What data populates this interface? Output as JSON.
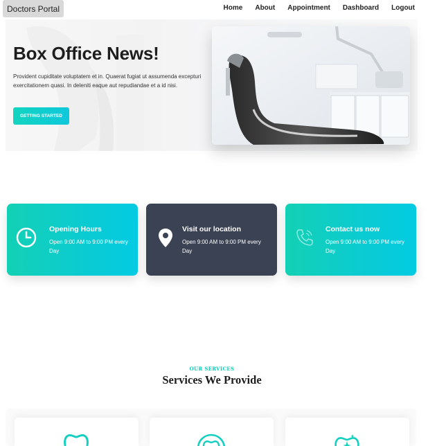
{
  "brand": {
    "label": "Doctors Portal"
  },
  "nav": {
    "items": [
      {
        "label": "Home"
      },
      {
        "label": "About"
      },
      {
        "label": "Appointment"
      },
      {
        "label": "Dashboard"
      },
      {
        "label": "Logout"
      }
    ]
  },
  "hero": {
    "title": "Box Office News!",
    "text": "Provident cupiditate voluptatem et in. Quaerat fugiat ut assumenda excepturi exercitationem quasi. In deleniti eaque aut repudiandae et a id nisi.",
    "button_label": "GETTING STARTED"
  },
  "info_cards": [
    {
      "title": "Opening Hours",
      "text": "Open 9:00 AM to 9:00 PM every Day",
      "icon": "clock-icon",
      "style": "teal"
    },
    {
      "title": "Visit our location",
      "text": "Open 9:00 AM to 9:00 PM every Day",
      "icon": "location-pin-icon",
      "style": "dark"
    },
    {
      "title": "Contact us now",
      "text": "Open 9:00 AM to 9:00 PM every Day",
      "icon": "phone-icon",
      "style": "teal"
    }
  ],
  "services": {
    "eyebrow": "OUR SERVICES",
    "title": "Services We Provide",
    "cards": [
      {
        "icon": "tooth-icon"
      },
      {
        "icon": "tooth-cavity-icon"
      },
      {
        "icon": "tooth-whitening-icon"
      }
    ]
  },
  "colors": {
    "accent": "#12d4bf",
    "accent_cyan": "#03cbe2",
    "dark_card": "#3b4254"
  }
}
